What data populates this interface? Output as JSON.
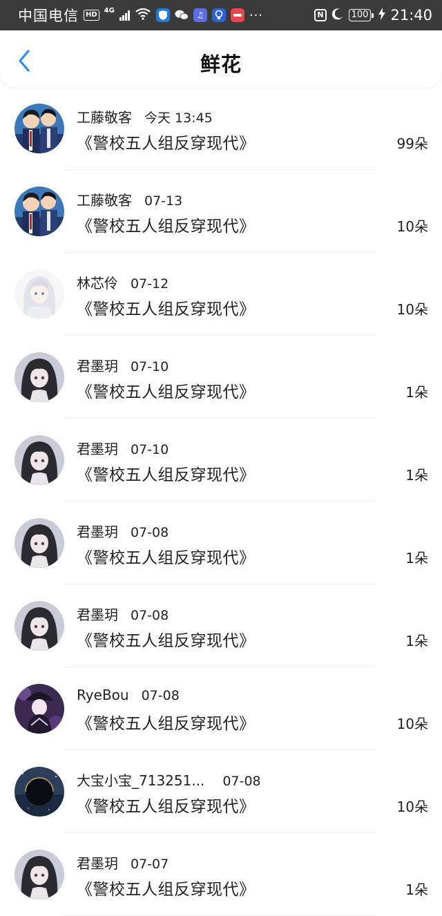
{
  "status_bar": {
    "carrier": "中国电信",
    "hd": "HD",
    "network": "4G",
    "nfc": "N",
    "battery": "100",
    "time": "21:40",
    "more": "···"
  },
  "header": {
    "title": "鲜花",
    "back_icon": "chevron-left-icon",
    "back_color": "#2a8cf0"
  },
  "items": [
    {
      "name": "工藤敬客",
      "date": "今天 13:45",
      "book": "《警校五人组反穿现代》",
      "count": "99朵",
      "avatar": "detective-duo-avatar"
    },
    {
      "name": "工藤敬客",
      "date": "07-13",
      "book": "《警校五人组反穿现代》",
      "count": "10朵",
      "avatar": "detective-duo-avatar"
    },
    {
      "name": "林芯伶",
      "date": "07-12",
      "book": "《警校五人组反穿现代》",
      "count": "10朵",
      "avatar": "white-hair-girl-avatar"
    },
    {
      "name": "君墨玥",
      "date": "07-10",
      "book": "《警校五人组反穿现代》",
      "count": "1朵",
      "avatar": "dark-hair-girl-avatar"
    },
    {
      "name": "君墨玥",
      "date": "07-10",
      "book": "《警校五人组反穿现代》",
      "count": "1朵",
      "avatar": "dark-hair-girl-avatar"
    },
    {
      "name": "君墨玥",
      "date": "07-08",
      "book": "《警校五人组反穿现代》",
      "count": "1朵",
      "avatar": "dark-hair-girl-avatar"
    },
    {
      "name": "君墨玥",
      "date": "07-08",
      "book": "《警校五人组反穿现代》",
      "count": "1朵",
      "avatar": "dark-hair-girl-avatar"
    },
    {
      "name": "RyeBou",
      "date": "07-08",
      "book": "《警校五人组反穿现代》",
      "count": "10朵",
      "avatar": "purple-witch-avatar"
    },
    {
      "name": "大宝小宝_713251...",
      "date": "07-08",
      "book": "《警校五人组反穿现代》",
      "count": "10朵",
      "avatar": "dark-planet-avatar"
    },
    {
      "name": "君墨玥",
      "date": "07-07",
      "book": "《警校五人组反穿现代》",
      "count": "1朵",
      "avatar": "dark-hair-girl-avatar"
    }
  ]
}
